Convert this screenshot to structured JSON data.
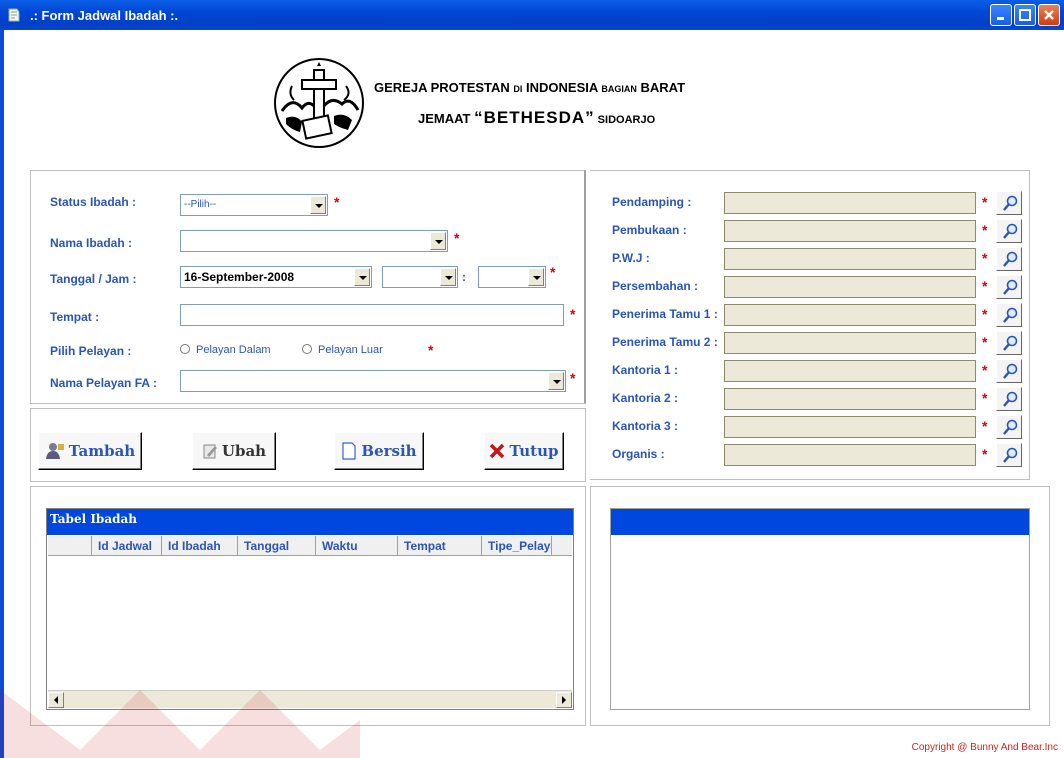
{
  "window": {
    "title": ".: Form Jadwal Ibadah :."
  },
  "header": {
    "line1_a": "GEREJA PROTESTAN ",
    "line1_b": "DI",
    "line1_c": " INDONESIA ",
    "line1_d": "BAGIAN",
    "line1_e": " BARAT",
    "line2_a": "JEMAAT ",
    "line2_b": "“BETHESDA”",
    "line2_c": " SIDOARJO"
  },
  "form": {
    "status_label": "Status Ibadah :",
    "status_value": "--Pilih--",
    "nama_label": "Nama Ibadah :",
    "nama_value": "",
    "tanggal_label": "Tanggal / Jam :",
    "tanggal_value": "16-September-2008",
    "jam_value": "",
    "menit_value": "",
    "time_sep": ":",
    "tempat_label": "Tempat :",
    "tempat_value": "",
    "pelayan_label": "Pilih Pelayan :",
    "radio_dalam": "Pelayan Dalam",
    "radio_luar": "Pelayan Luar",
    "pelayan_fa_label": "Nama Pelayan FA :",
    "pelayan_fa_value": "",
    "required": "*"
  },
  "right_form": {
    "fields": [
      {
        "label": "Pendamping :",
        "value": ""
      },
      {
        "label": "Pembukaan :",
        "value": ""
      },
      {
        "label": "P.W.J :",
        "value": ""
      },
      {
        "label": "Persembahan :",
        "value": ""
      },
      {
        "label": "Penerima Tamu 1 :",
        "value": ""
      },
      {
        "label": "Penerima Tamu 2 :",
        "value": ""
      },
      {
        "label": "Kantoria 1 :",
        "value": ""
      },
      {
        "label": "Kantoria 2 :",
        "value": ""
      },
      {
        "label": "Kantoria 3 :",
        "value": ""
      },
      {
        "label": "Organis :",
        "value": ""
      }
    ]
  },
  "buttons": {
    "tambah": "Tambah",
    "ubah": "Ubah",
    "bersih": "Bersih",
    "tutup": "Tutup"
  },
  "table": {
    "caption": "Tabel Ibadah",
    "columns": [
      "Id Jadwal",
      "Id Ibadah",
      "Tanggal",
      "Waktu",
      "Tempat",
      "Tipe_Pelaya"
    ]
  },
  "footer": {
    "copyright": "Copyright @ Bunny And Bear.Inc"
  },
  "colors": {
    "title_bar": "#0046d5",
    "label_blue": "#2a55b8",
    "required_red": "#e00000",
    "grid_header": "#0047e0"
  }
}
